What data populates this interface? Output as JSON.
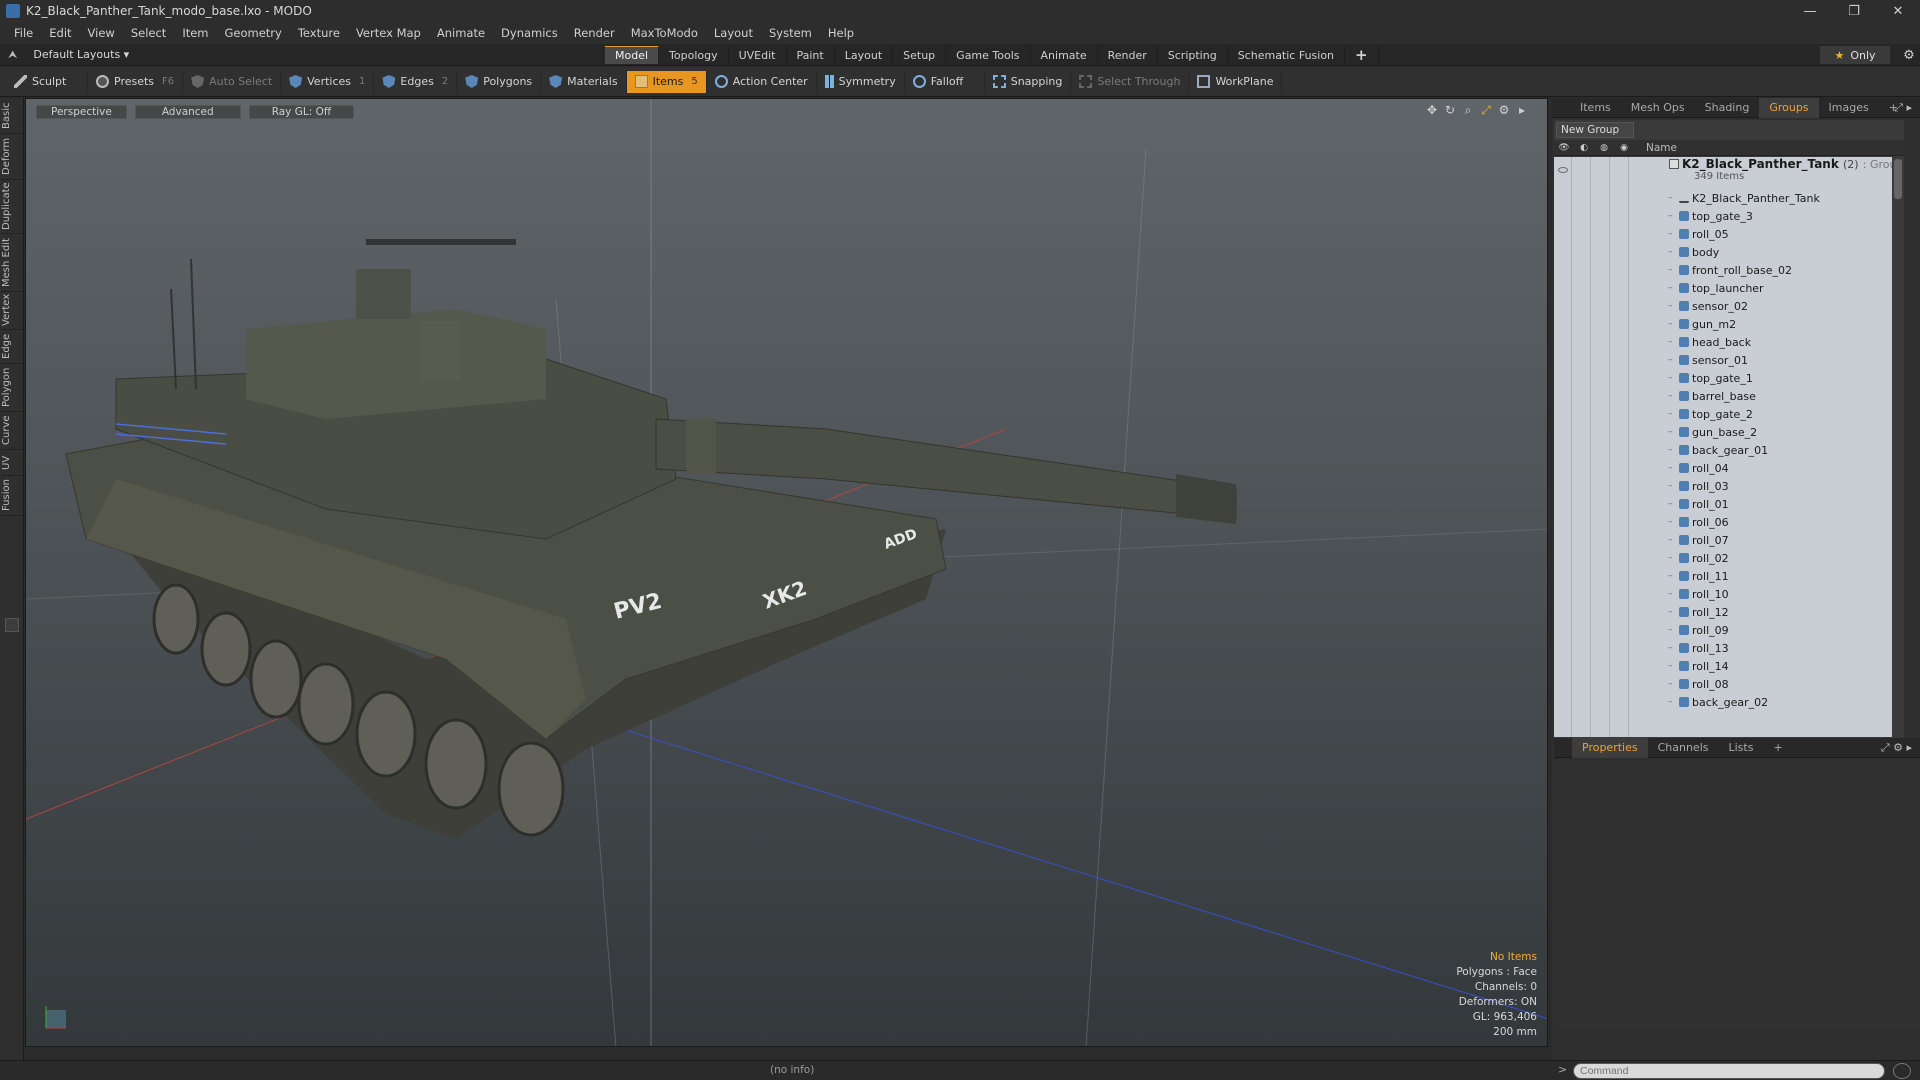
{
  "window": {
    "title": "K2_Black_Panther_Tank_modo_base.lxo - MODO",
    "minimize": "—",
    "restore": "❐",
    "close": "✕"
  },
  "menu": [
    "File",
    "Edit",
    "View",
    "Select",
    "Item",
    "Geometry",
    "Texture",
    "Vertex Map",
    "Animate",
    "Dynamics",
    "Render",
    "MaxToModo",
    "Layout",
    "System",
    "Help"
  ],
  "layout": {
    "name": "Default Layouts ▾",
    "tabs": [
      "Model",
      "Topology",
      "UVEdit",
      "Paint",
      "Layout",
      "Setup",
      "Game Tools",
      "Animate",
      "Render",
      "Scripting",
      "Schematic Fusion"
    ],
    "active_tab": "Model",
    "only_label": "Only"
  },
  "toolbar": {
    "sculpt": "Sculpt",
    "presets": "Presets",
    "presets_key": "F6",
    "auto_select": "Auto Select",
    "vertices": "Vertices",
    "vertices_key": "1",
    "edges": "Edges",
    "edges_key": "2",
    "polygons": "Polygons",
    "materials": "Materials",
    "items": "Items",
    "items_key": "5",
    "action_center": "Action Center",
    "symmetry": "Symmetry",
    "falloff": "Falloff",
    "snapping": "Snapping",
    "select_through": "Select Through",
    "workplane": "WorkPlane"
  },
  "left_tabs": [
    "Basic",
    "Deform",
    "Duplicate",
    "Mesh Edit",
    "Vertex",
    "Edge",
    "Polygon",
    "Curve",
    "UV",
    "Fusion"
  ],
  "viewport": {
    "perspective": "Perspective",
    "advanced": "Advanced",
    "raygl": "Ray GL: Off",
    "tank_labels": {
      "side": "PV2",
      "front": "XK2",
      "plate": "ADD"
    },
    "info": {
      "no_items": "No Items",
      "polygons": "Polygons : Face",
      "channels": "Channels: 0",
      "deformers": "Deformers: ON",
      "gl": "GL: 963,406",
      "scale": "200 mm"
    }
  },
  "panel": {
    "tabs": [
      "Items",
      "Mesh Ops",
      "Shading",
      "Groups",
      "Images"
    ],
    "active_tab": "Groups",
    "new_group": "New Group",
    "name_header": "Name",
    "group": {
      "name": "K2_Black_Panther_Tank",
      "count": "(2)",
      "type": ": Group",
      "items": "349 Items"
    },
    "rows": [
      "K2_Black_Panther_Tank",
      "top_gate_3",
      "roll_05",
      "body",
      "front_roll_base_02",
      "top_launcher",
      "sensor_02",
      "gun_m2",
      "head_back",
      "sensor_01",
      "top_gate_1",
      "barrel_base",
      "top_gate_2",
      "gun_base_2",
      "back_gear_01",
      "roll_04",
      "roll_03",
      "roll_01",
      "roll_06",
      "roll_07",
      "roll_02",
      "roll_11",
      "roll_10",
      "roll_12",
      "roll_09",
      "roll_13",
      "roll_14",
      "roll_08",
      "back_gear_02"
    ],
    "bottom_tabs": [
      "Properties",
      "Channels",
      "Lists"
    ],
    "bottom_active": "Properties"
  },
  "status": {
    "no_info": "(no info)",
    "command_placeholder": "Command",
    "prompt": ">"
  },
  "colors": {
    "accent": "#e8961f",
    "tree_bg": "#c8ced3",
    "viewport_top": "#5f6568"
  }
}
